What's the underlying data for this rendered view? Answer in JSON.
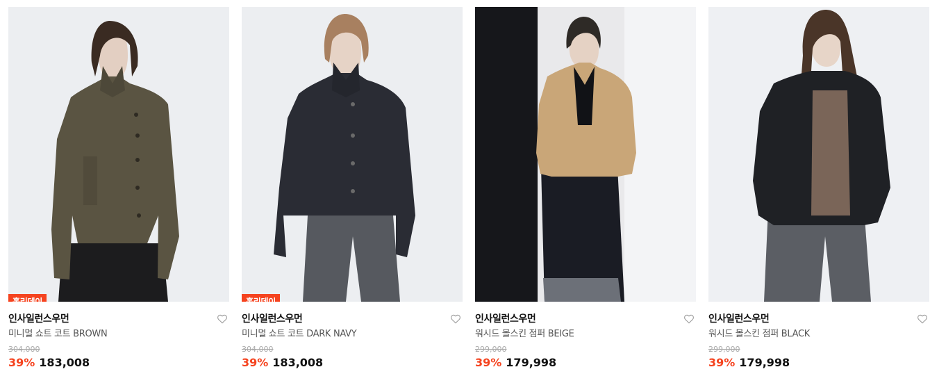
{
  "products": [
    {
      "badge": "홀리데이",
      "brand": "인사일런스우먼",
      "name": "미니멀 쇼트 코트 BROWN",
      "original_price": "304,000",
      "discount_rate": "39%",
      "sale_price": "183,008",
      "like_icon": "heart-outline-icon",
      "jacket_color": "#5a5442",
      "background_color": "#eceef1"
    },
    {
      "badge": "홀리데이",
      "brand": "인사일런스우먼",
      "name": "미니멀 쇼트 코트 DARK NAVY",
      "original_price": "304,000",
      "discount_rate": "39%",
      "sale_price": "183,008",
      "like_icon": "heart-outline-icon",
      "jacket_color": "#2a2c34",
      "background_color": "#eceef1"
    },
    {
      "brand": "인사일런스우먼",
      "name": "워시드 몰스킨 점퍼 BEIGE",
      "original_price": "299,000",
      "discount_rate": "39%",
      "sale_price": "179,998",
      "like_icon": "heart-outline-icon",
      "jacket_color": "#c9a678",
      "background_color": "#e9e9eb"
    },
    {
      "brand": "인사일런스우먼",
      "name": "워시드 몰스킨 점퍼 BLACK",
      "original_price": "299,000",
      "discount_rate": "39%",
      "sale_price": "179,998",
      "like_icon": "heart-outline-icon",
      "jacket_color": "#1f2125",
      "background_color": "#eef0f3"
    }
  ],
  "colors": {
    "accent": "#f5431f"
  }
}
